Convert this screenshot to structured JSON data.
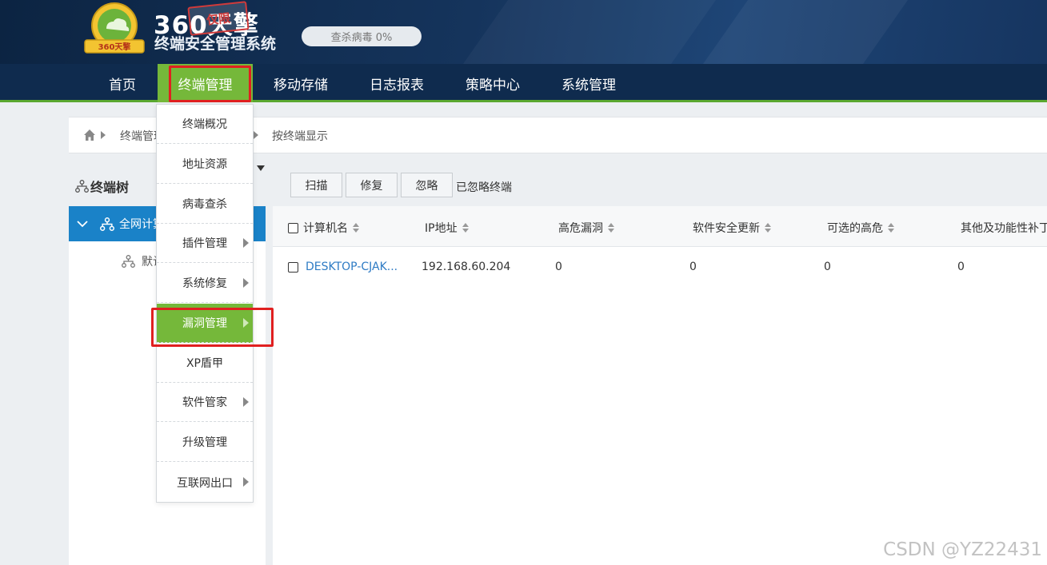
{
  "header": {
    "logo_title": "360天擎",
    "logo_stamp": "仅限",
    "logo_badge_text": "360天擎",
    "logo_subtitle": "终端安全管理系统",
    "scan_status": "查杀病毒 0%"
  },
  "nav": {
    "items": [
      {
        "label": "首页"
      },
      {
        "label": "终端管理"
      },
      {
        "label": "移动存储"
      },
      {
        "label": "日志报表"
      },
      {
        "label": "策略中心"
      },
      {
        "label": "系统管理"
      }
    ],
    "active_index": 1
  },
  "breadcrumb": {
    "items": [
      "终端管理",
      "按终端显示"
    ]
  },
  "tree": {
    "title": "终端树",
    "root_label": "全网计算机",
    "child_label": "默认分组"
  },
  "toolbar": {
    "scan": "扫描",
    "repair": "修复",
    "ignore": "忽略",
    "ignored_terminals": "已忽略终端"
  },
  "table": {
    "columns": [
      "计算机名",
      "IP地址",
      "高危漏洞",
      "软件安全更新",
      "可选的高危",
      "其他及功能性补丁"
    ],
    "rows": [
      {
        "name": "DESKTOP-CJAK...",
        "ip": "192.168.60.204",
        "high_risk": "0",
        "software_updates": "0",
        "optional_high": "0",
        "other": "0"
      }
    ]
  },
  "dropdown": {
    "items": [
      {
        "label": "终端概况",
        "has_submenu": false
      },
      {
        "label": "地址资源",
        "has_submenu": false
      },
      {
        "label": "病毒查杀",
        "has_submenu": false
      },
      {
        "label": "插件管理",
        "has_submenu": true
      },
      {
        "label": "系统修复",
        "has_submenu": true
      },
      {
        "label": "漏洞管理",
        "has_submenu": true
      },
      {
        "label": "XP盾甲",
        "has_submenu": false
      },
      {
        "label": "软件管家",
        "has_submenu": true
      },
      {
        "label": "升级管理",
        "has_submenu": false
      },
      {
        "label": "互联网出口",
        "has_submenu": true
      }
    ],
    "active_index": 5
  },
  "watermark": "CSDN @YZ22431",
  "colors": {
    "header_bg": "#0f2b4e",
    "accent_green": "#75b83a",
    "tree_selected": "#1a82c8",
    "link_blue": "#2e7bc4",
    "highlight_red": "#e02020"
  }
}
